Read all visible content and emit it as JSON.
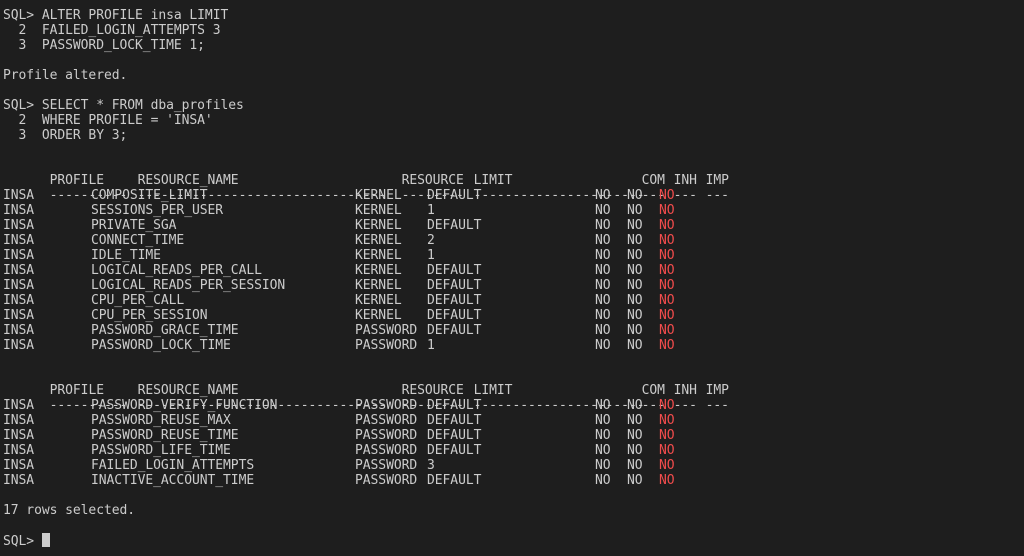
{
  "session": {
    "alter_cmd": [
      "SQL> ALTER PROFILE insa LIMIT",
      "  2  FAILED_LOGIN_ATTEMPTS 3",
      "  3  PASSWORD_LOCK_TIME 1;"
    ],
    "alter_result": "Profile altered.",
    "select_cmd": [
      "SQL> SELECT * FROM dba_profiles",
      "  2  WHERE PROFILE = 'INSA'",
      "  3  ORDER BY 3;"
    ],
    "rows_selected": "17 rows selected.",
    "prompt": "SQL> "
  },
  "columns": {
    "headers": [
      "PROFILE",
      "RESOURCE_NAME",
      "RESOURCE",
      "LIMIT",
      "COM",
      "INH",
      "IMP"
    ],
    "underline": [
      "----------",
      "--------------------------------",
      "--------",
      "----------------------",
      "---",
      "---",
      "---"
    ]
  },
  "page1": [
    [
      "INSA",
      "COMPOSITE_LIMIT",
      "KERNEL",
      "DEFAULT",
      "NO",
      "NO",
      "NO"
    ],
    [
      "INSA",
      "SESSIONS_PER_USER",
      "KERNEL",
      "1",
      "NO",
      "NO",
      "NO"
    ],
    [
      "INSA",
      "PRIVATE_SGA",
      "KERNEL",
      "DEFAULT",
      "NO",
      "NO",
      "NO"
    ],
    [
      "INSA",
      "CONNECT_TIME",
      "KERNEL",
      "2",
      "NO",
      "NO",
      "NO"
    ],
    [
      "INSA",
      "IDLE_TIME",
      "KERNEL",
      "1",
      "NO",
      "NO",
      "NO"
    ],
    [
      "INSA",
      "LOGICAL_READS_PER_CALL",
      "KERNEL",
      "DEFAULT",
      "NO",
      "NO",
      "NO"
    ],
    [
      "INSA",
      "LOGICAL_READS_PER_SESSION",
      "KERNEL",
      "DEFAULT",
      "NO",
      "NO",
      "NO"
    ],
    [
      "INSA",
      "CPU_PER_CALL",
      "KERNEL",
      "DEFAULT",
      "NO",
      "NO",
      "NO"
    ],
    [
      "INSA",
      "CPU_PER_SESSION",
      "KERNEL",
      "DEFAULT",
      "NO",
      "NO",
      "NO"
    ],
    [
      "INSA",
      "PASSWORD_GRACE_TIME",
      "PASSWORD",
      "DEFAULT",
      "NO",
      "NO",
      "NO"
    ],
    [
      "INSA",
      "PASSWORD_LOCK_TIME",
      "PASSWORD",
      "1",
      "NO",
      "NO",
      "NO"
    ]
  ],
  "page2": [
    [
      "INSA",
      "PASSWORD_VERIFY_FUNCTION",
      "PASSWORD",
      "DEFAULT",
      "NO",
      "NO",
      "NO"
    ],
    [
      "INSA",
      "PASSWORD_REUSE_MAX",
      "PASSWORD",
      "DEFAULT",
      "NO",
      "NO",
      "NO"
    ],
    [
      "INSA",
      "PASSWORD_REUSE_TIME",
      "PASSWORD",
      "DEFAULT",
      "NO",
      "NO",
      "NO"
    ],
    [
      "INSA",
      "PASSWORD_LIFE_TIME",
      "PASSWORD",
      "DEFAULT",
      "NO",
      "NO",
      "NO"
    ],
    [
      "INSA",
      "FAILED_LOGIN_ATTEMPTS",
      "PASSWORD",
      "3",
      "NO",
      "NO",
      "NO"
    ],
    [
      "INSA",
      "INACTIVE_ACCOUNT_TIME",
      "PASSWORD",
      "DEFAULT",
      "NO",
      "NO",
      "NO"
    ]
  ],
  "colors": {
    "background": "#1e1e1e",
    "text": "#cccccc",
    "imp_no": "#f14c4c"
  }
}
